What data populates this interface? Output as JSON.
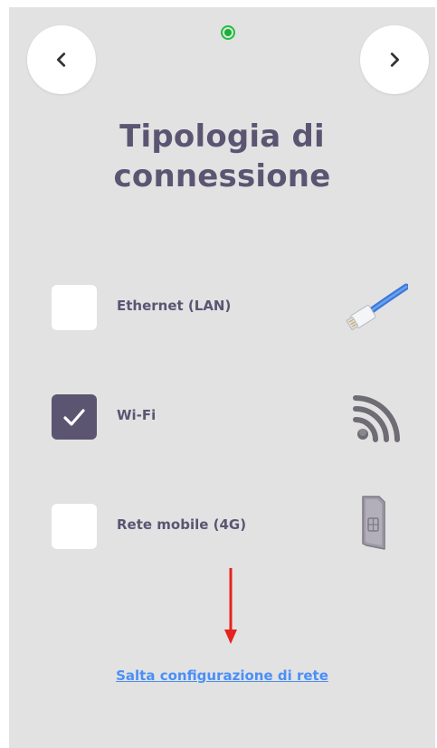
{
  "header": {
    "prev_icon": "chevron-left-icon",
    "next_icon": "chevron-right-icon",
    "status_color": "#1ec23b"
  },
  "title": {
    "line1": "Tipologia di",
    "line2": "connessione"
  },
  "options": [
    {
      "label": "Ethernet (LAN)",
      "checked": false,
      "icon": "ethernet-cable-icon"
    },
    {
      "label": "Wi-Fi",
      "checked": true,
      "icon": "wifi-icon"
    },
    {
      "label": "Rete mobile (4G)",
      "checked": false,
      "icon": "sim-card-icon"
    }
  ],
  "skip_link": "Salta configurazione di rete",
  "colors": {
    "background": "#e2e2e3",
    "accent": "#5b5572",
    "link": "#4b8ff6",
    "hint_arrow": "#e5231f"
  }
}
